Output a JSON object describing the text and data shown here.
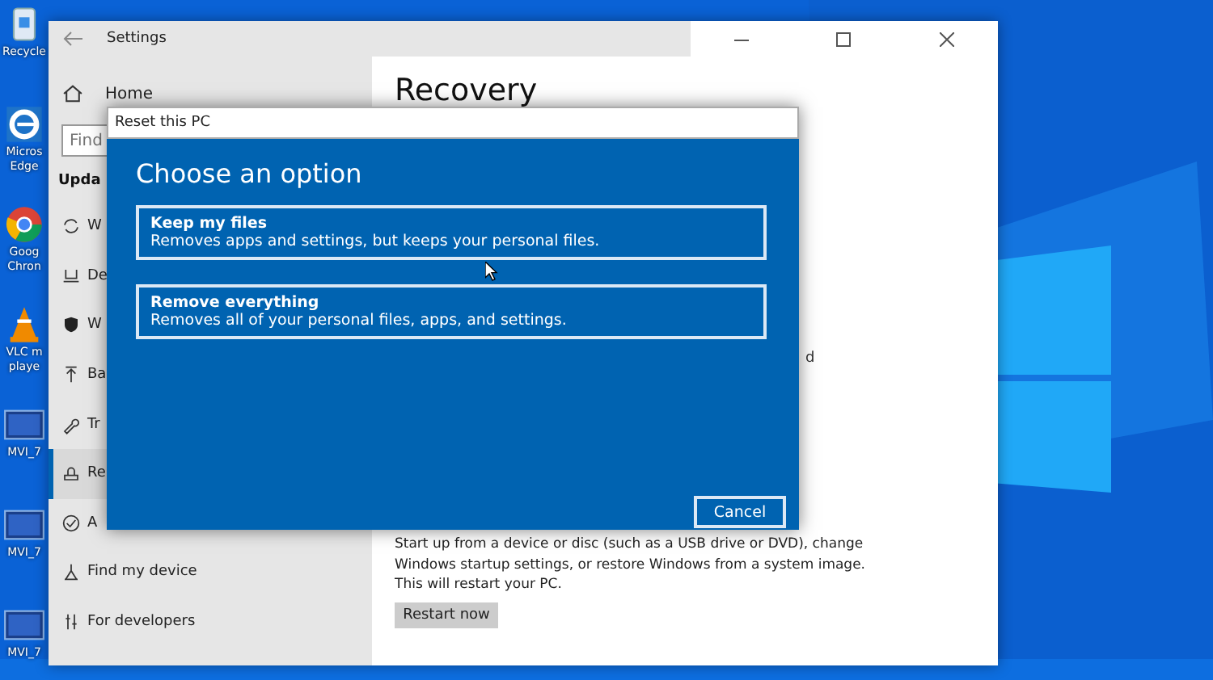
{
  "desktop": {
    "icons": [
      {
        "label": "Recycle",
        "kind": "recycle"
      },
      {
        "label": "Micros Edge",
        "kind": "edge"
      },
      {
        "label": "Goog Chron",
        "kind": "chrome"
      },
      {
        "label": "VLC m playe",
        "kind": "vlc"
      },
      {
        "label": "MVI_7",
        "kind": "video"
      },
      {
        "label": "MVI_7",
        "kind": "video"
      },
      {
        "label": "MVI_7",
        "kind": "video"
      }
    ]
  },
  "settings": {
    "title": "Settings",
    "home": "Home",
    "search": {
      "placeholder": "Find"
    },
    "section": "Upda",
    "items": [
      {
        "label": "W",
        "kind": "sync",
        "selected": false
      },
      {
        "label": "De",
        "kind": "delivery",
        "selected": false
      },
      {
        "label": "W",
        "kind": "shield",
        "selected": false
      },
      {
        "label": "Ba",
        "kind": "backup",
        "selected": false
      },
      {
        "label": "Tr",
        "kind": "wrench",
        "selected": false
      },
      {
        "label": "Re",
        "kind": "recovery",
        "selected": true
      },
      {
        "label": "A",
        "kind": "check",
        "selected": false
      },
      {
        "label": "Find my device",
        "kind": "person",
        "selected": false
      },
      {
        "label": "For developers",
        "kind": "dev",
        "selected": false
      }
    ],
    "page_title": "Recovery",
    "behind_text": "d",
    "startup_text": "Start up from a device or disc (such as a USB drive or DVD), change Windows startup settings, or restore Windows from a system image. This will restart your PC.",
    "restart_button": "Restart now"
  },
  "dialog": {
    "title": "Reset this PC",
    "heading": "Choose an option",
    "options": [
      {
        "title": "Keep my files",
        "description": "Removes apps and settings, but keeps your personal files."
      },
      {
        "title": "Remove everything",
        "description": "Removes all of your personal files, apps, and settings."
      }
    ],
    "cancel": "Cancel"
  }
}
